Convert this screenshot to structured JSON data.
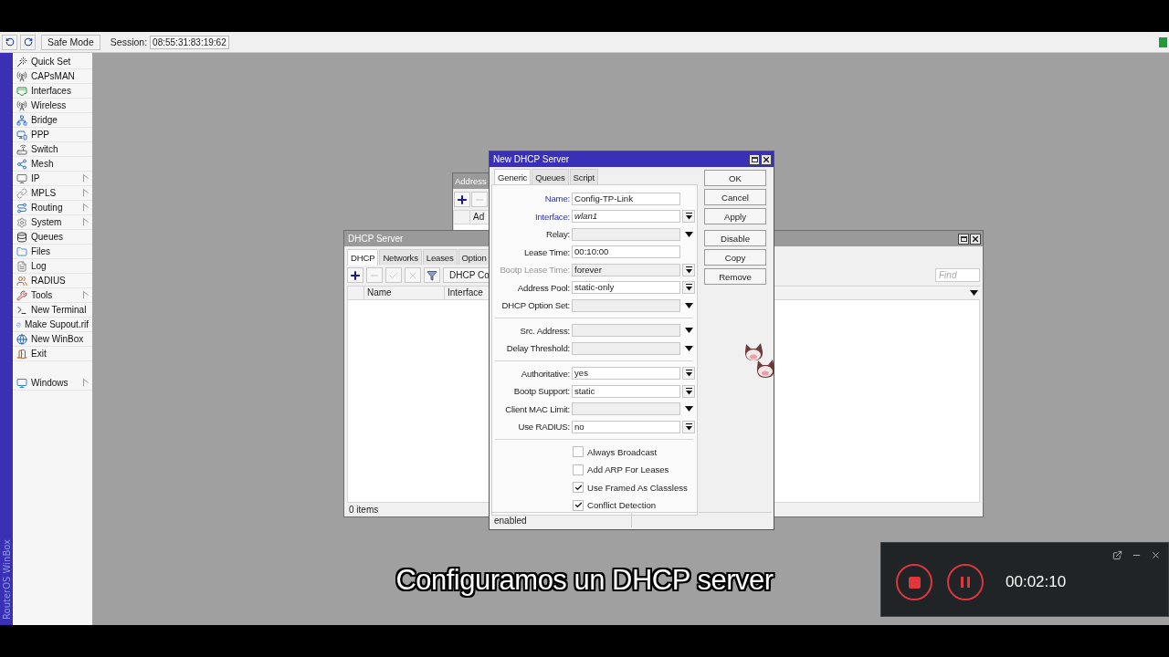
{
  "toolbar": {
    "safe_mode": "Safe Mode",
    "session_label": "Session:",
    "session": "08:55:31:83:19:62"
  },
  "sidebar": {
    "brand": "RouterOS WinBox",
    "items": [
      {
        "label": "Quick Set",
        "submenu": false
      },
      {
        "label": "CAPsMAN",
        "submenu": false
      },
      {
        "label": "Interfaces",
        "submenu": false
      },
      {
        "label": "Wireless",
        "submenu": false
      },
      {
        "label": "Bridge",
        "submenu": false
      },
      {
        "label": "PPP",
        "submenu": false
      },
      {
        "label": "Switch",
        "submenu": false
      },
      {
        "label": "Mesh",
        "submenu": false
      },
      {
        "label": "IP",
        "submenu": true
      },
      {
        "label": "MPLS",
        "submenu": true
      },
      {
        "label": "Routing",
        "submenu": true
      },
      {
        "label": "System",
        "submenu": true
      },
      {
        "label": "Queues",
        "submenu": false
      },
      {
        "label": "Files",
        "submenu": false
      },
      {
        "label": "Log",
        "submenu": false
      },
      {
        "label": "RADIUS",
        "submenu": false
      },
      {
        "label": "Tools",
        "submenu": true
      },
      {
        "label": "New Terminal",
        "submenu": false
      },
      {
        "label": "Make Supout.rif",
        "submenu": false
      },
      {
        "label": "New WinBox",
        "submenu": false
      },
      {
        "label": "Exit",
        "submenu": false
      }
    ],
    "bottom_items": [
      {
        "label": "Windows",
        "submenu": true
      }
    ]
  },
  "address_window": {
    "title": "Address",
    "tools": [
      {
        "kind": "add",
        "disabled": false
      },
      {
        "kind": "remove",
        "disabled": true
      }
    ],
    "column": "Ad"
  },
  "dhcp_window": {
    "title": "DHCP Server",
    "tabs": [
      {
        "label": "DHCP",
        "selected": true
      },
      {
        "label": "Networks",
        "selected": false
      },
      {
        "label": "Leases",
        "selected": false
      },
      {
        "label": "Option",
        "selected": false
      }
    ],
    "tools": [
      {
        "kind": "add",
        "disabled": false
      },
      {
        "kind": "remove",
        "disabled": true
      },
      {
        "kind": "enable",
        "disabled": true
      },
      {
        "kind": "disable",
        "disabled": true
      },
      {
        "kind": "filter",
        "disabled": false
      }
    ],
    "toolbar_button": "DHCP Co",
    "find_placeholder": "Find",
    "columns": [
      "Name",
      "Interface"
    ],
    "status": "0 items"
  },
  "dialog": {
    "title": "New DHCP Server",
    "tabs": [
      {
        "label": "Generic",
        "selected": true
      },
      {
        "label": "Queues",
        "selected": false
      },
      {
        "label": "Script",
        "selected": false
      }
    ],
    "groups": [
      [
        {
          "label": "Name:",
          "highlighted": true,
          "kind": "text",
          "value": "Config-TP-Link"
        },
        {
          "label": "Interface:",
          "highlighted": true,
          "kind": "select",
          "value": "wlan1",
          "italic": true
        },
        {
          "label": "Relay:",
          "highlighted": false,
          "kind": "optional"
        },
        {
          "label": "Lease Time:",
          "highlighted": false,
          "kind": "text",
          "value": "00:10:00"
        },
        {
          "label": "Bootp Lease Time:",
          "highlighted": false,
          "kind": "select",
          "value": "forever",
          "disabled": true
        },
        {
          "label": "Address Pool:",
          "highlighted": false,
          "kind": "select",
          "value": "static-only"
        },
        {
          "label": "DHCP Option Set:",
          "highlighted": false,
          "kind": "optional"
        }
      ],
      [
        {
          "label": "Src. Address:",
          "highlighted": false,
          "kind": "optional"
        },
        {
          "label": "Delay Threshold:",
          "highlighted": false,
          "kind": "optional"
        }
      ],
      [
        {
          "label": "Authoritative:",
          "highlighted": false,
          "kind": "select",
          "value": "yes"
        },
        {
          "label": "Bootp Support:",
          "highlighted": false,
          "kind": "select",
          "value": "static"
        },
        {
          "label": "Client MAC Limit:",
          "highlighted": false,
          "kind": "optional"
        },
        {
          "label": "Use RADIUS:",
          "highlighted": false,
          "kind": "select",
          "value": "no"
        }
      ]
    ],
    "checkboxes": [
      {
        "label": "Always Broadcast",
        "checked": false
      },
      {
        "label": "Add ARP For Leases",
        "checked": false
      },
      {
        "label": "Use Framed As Classless",
        "checked": true
      },
      {
        "label": "Conflict Detection",
        "checked": true
      }
    ],
    "buttons": [
      "OK",
      "Cancel",
      "Apply",
      "Disable",
      "Copy",
      "Remove"
    ],
    "status": "enabled"
  },
  "subtitle": "Configuramos un DHCP server",
  "recorder": {
    "time": "00:02:10"
  }
}
